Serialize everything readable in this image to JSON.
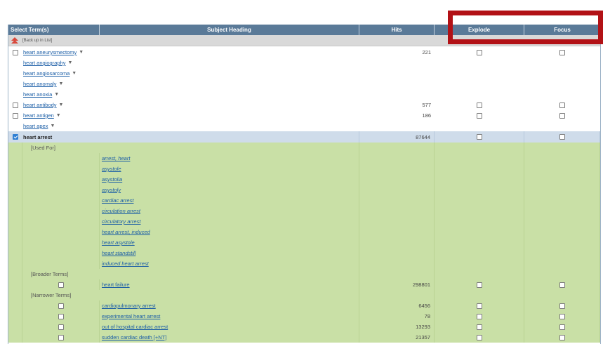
{
  "header": {
    "select_terms": "Select Term(s)",
    "subject_heading": "Subject Heading",
    "hits": "Hits",
    "explode": "Explode",
    "focus": "Focus"
  },
  "back_label": "[Back up in List]",
  "terms_top": [
    {
      "label": "heart aneurysmectomy",
      "hits": "221",
      "has_checkbox": true
    },
    {
      "label": "heart angiography",
      "hits": "",
      "has_checkbox": false
    },
    {
      "label": "heart angiosarcoma",
      "hits": "",
      "has_checkbox": false
    },
    {
      "label": "heart anomaly",
      "hits": "",
      "has_checkbox": false
    },
    {
      "label": "heart anoxia",
      "hits": "",
      "has_checkbox": false
    },
    {
      "label": "heart antibody",
      "hits": "577",
      "has_checkbox": true
    },
    {
      "label": "heart antigen",
      "hits": "186",
      "has_checkbox": true
    },
    {
      "label": "heart apex",
      "hits": "",
      "has_checkbox": false
    }
  ],
  "selected_term": {
    "label": "heart arrest",
    "hits": "87644",
    "checked": true
  },
  "used_for_label": "[Used For]",
  "used_for": [
    "arrest, heart",
    "asystole",
    "asystolia",
    "asystoly",
    "cardiac arrest",
    "circulation arrest",
    "circulatory arrest",
    "heart arrest, induced",
    "heart asystole",
    "heart standstill",
    "induced heart arrest"
  ],
  "broader_label": "[Broader Terms]",
  "broader": [
    {
      "label": "heart failure",
      "hits": "298801"
    }
  ],
  "narrower_label": "[Narrower Terms]",
  "narrower": [
    {
      "label": "cardiopulmonary arrest",
      "hits": "6456"
    },
    {
      "label": "experimental heart arrest",
      "hits": "78"
    },
    {
      "label": "out of hospital cardiac arrest",
      "hits": "13293"
    },
    {
      "label": "sudden cardiac death [+NT]",
      "hits": "21357"
    }
  ],
  "colors": {
    "header_bg": "#5a7a98",
    "selected_bg": "#cfdcea",
    "green_bg": "#c9e0a6",
    "link": "#1a5da6",
    "highlight_box": "#b21116",
    "back_arrow": "#d9473a"
  }
}
